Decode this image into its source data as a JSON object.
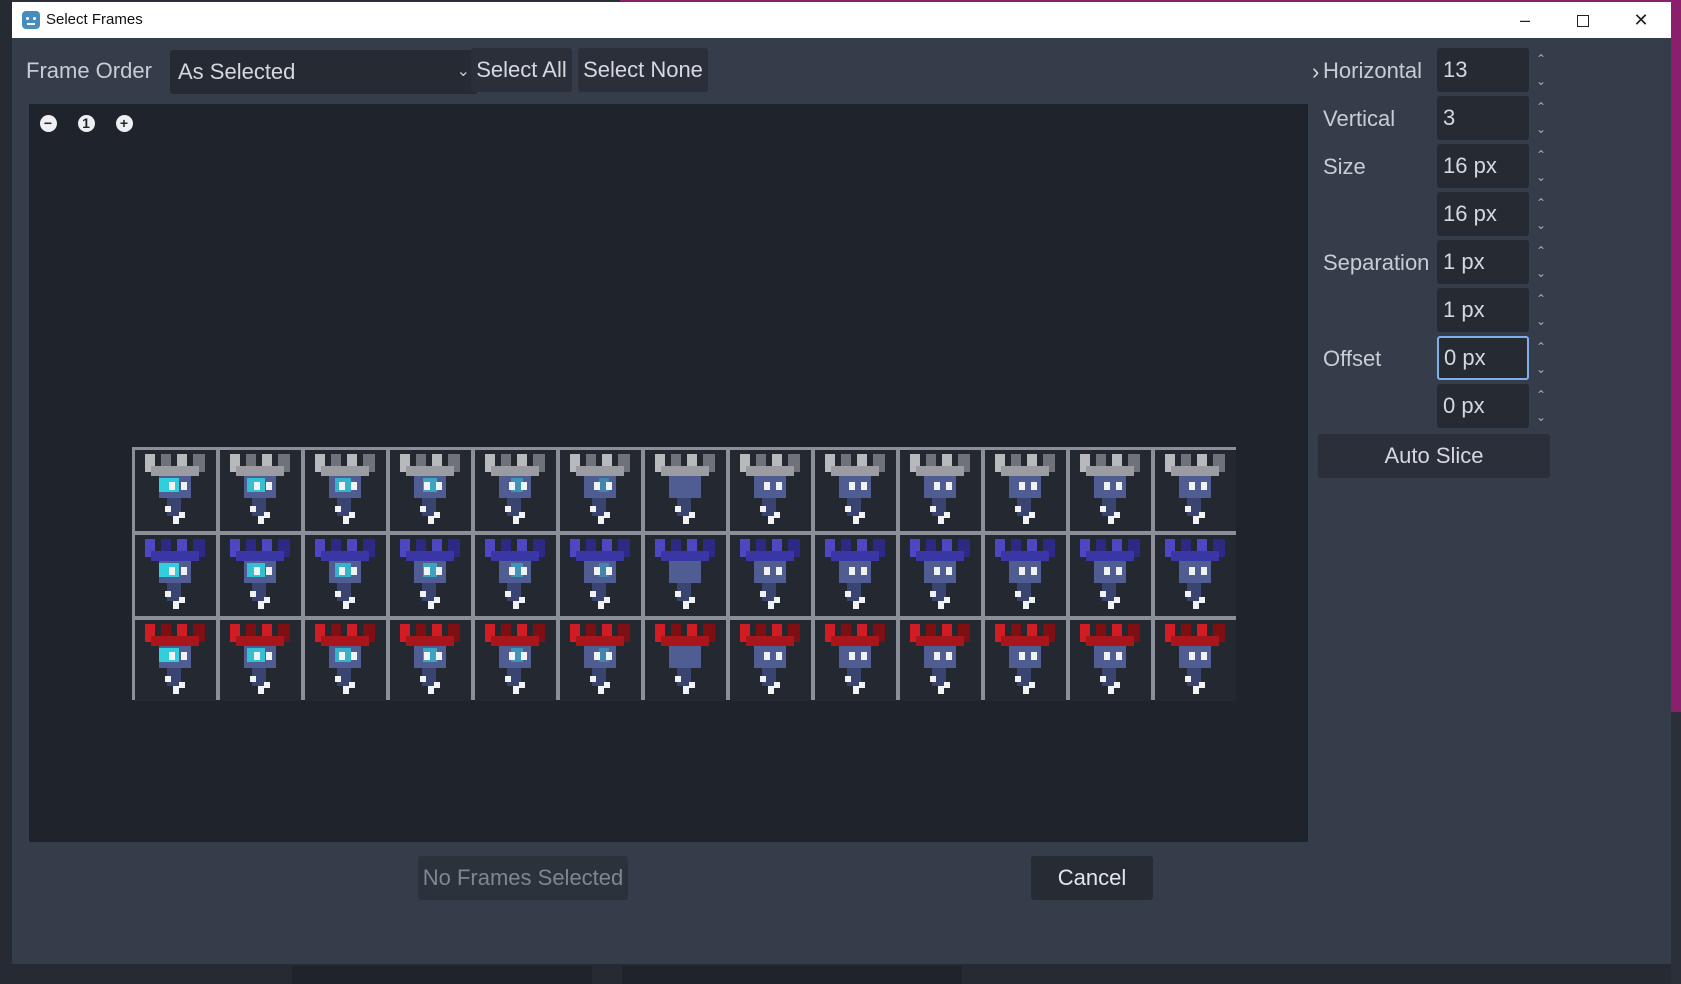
{
  "window": {
    "title": "Select Frames",
    "minimize_glyph": "–",
    "close_glyph": "✕"
  },
  "toolbar": {
    "frame_order_label": "Frame Order",
    "frame_order_value": "As Selected",
    "select_all_label": "Select All",
    "select_none_label": "Select None",
    "expand_glyph": "›"
  },
  "zoom": {
    "out_glyph": "−",
    "reset_glyph": "1",
    "in_glyph": "+"
  },
  "sheet": {
    "columns": 13,
    "rows": 3,
    "row_palettes": [
      "gray",
      "blue",
      "red"
    ]
  },
  "settings": {
    "horizontal_label": "Horizontal",
    "horizontal_value": "13",
    "vertical_label": "Vertical",
    "vertical_value": "3",
    "size_label": "Size",
    "size_x": "16 px",
    "size_y": "16 px",
    "separation_label": "Separation",
    "separation_x": "1 px",
    "separation_y": "1 px",
    "offset_label": "Offset",
    "offset_x": "0 px",
    "offset_y": "0 px",
    "auto_slice_label": "Auto Slice"
  },
  "footer": {
    "selection_status": "No Frames Selected",
    "cancel_label": "Cancel"
  },
  "colors": {
    "dialog_bg": "#363d4a",
    "canvas_bg": "#1f242c",
    "focus_border": "#7fb0ec",
    "crown_gray": "#8f9298",
    "crown_blue": "#4a44b8",
    "crown_red": "#c0161c",
    "glow_cyan": "#2fd4e0"
  }
}
